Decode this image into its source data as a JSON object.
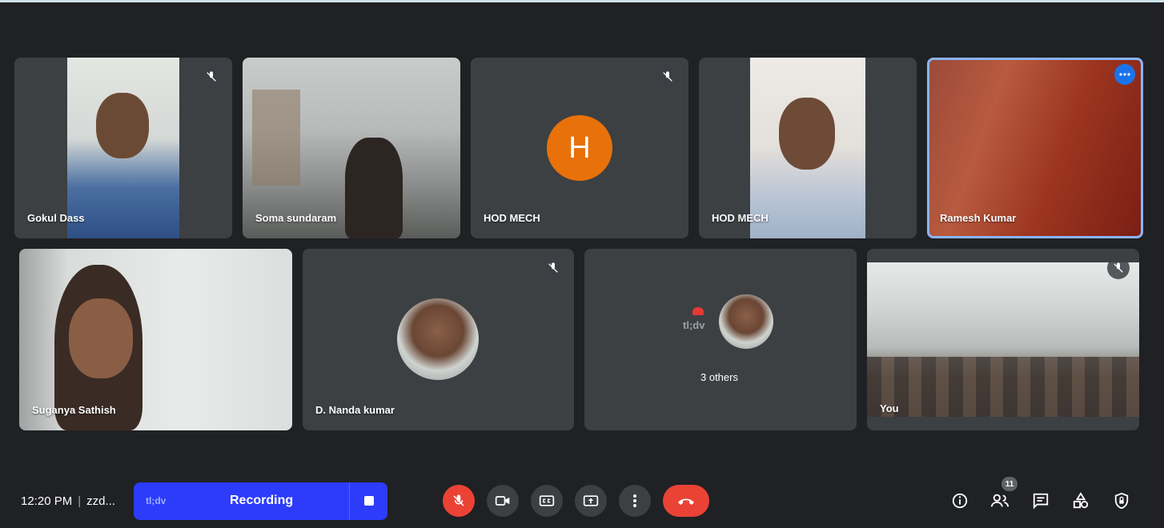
{
  "participants": {
    "gokul": {
      "name": "Gokul Dass"
    },
    "soma": {
      "name": "Soma sundaram"
    },
    "hod1": {
      "name": "HOD MECH",
      "initial": "H"
    },
    "hod2": {
      "name": "HOD MECH"
    },
    "ramesh": {
      "name": "Ramesh Kumar"
    },
    "suganya": {
      "name": "Suganya Sathish"
    },
    "nanda": {
      "name": "D. Nanda kumar"
    },
    "others": {
      "label": "3 others",
      "watermark": "tl;dv"
    },
    "you": {
      "name": "You"
    }
  },
  "bottom_bar": {
    "time": "12:20 PM",
    "separator": "|",
    "meeting_code": "zzd...",
    "recording": {
      "brand": "tl;dv",
      "label": "Recording"
    },
    "people_count": "11"
  },
  "icons": {
    "mic_off": "mic-off-icon",
    "camera": "camera-icon",
    "captions": "captions-icon",
    "present": "present-screen-icon",
    "more": "more-vert-icon",
    "hangup": "call-end-icon",
    "info": "info-icon",
    "people": "people-icon",
    "chat": "chat-icon",
    "activities": "activities-icon",
    "host": "host-controls-icon"
  },
  "colors": {
    "background": "#202124",
    "tile": "#3c4043",
    "record_bar": "#2c3cfa",
    "danger": "#ea4335",
    "avatar_orange": "#e8710a",
    "pin_highlight": "#8ab4f8"
  }
}
